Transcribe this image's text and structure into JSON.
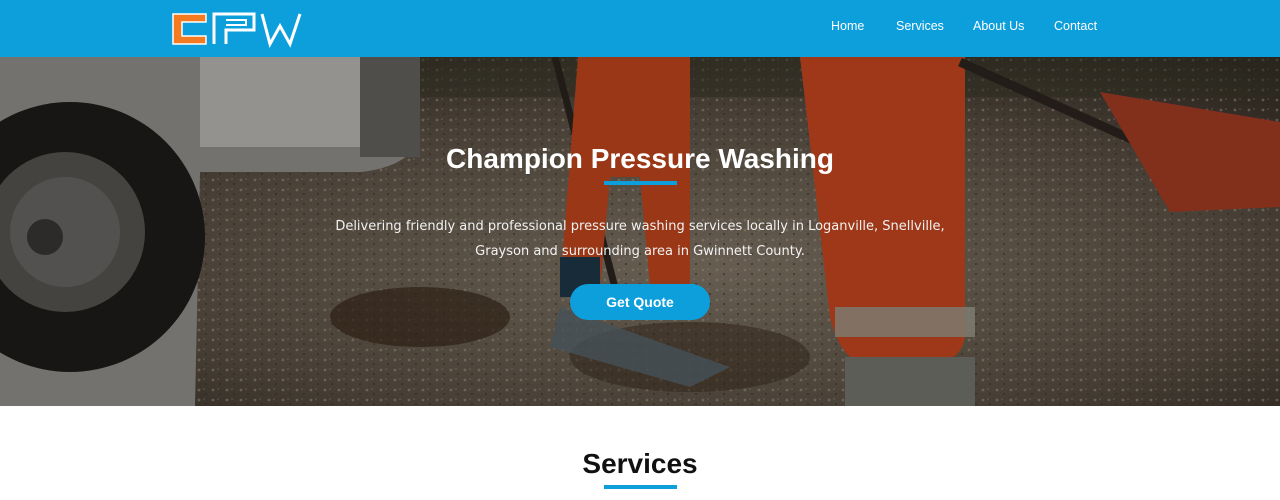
{
  "brand": {
    "logo_text": "CPW",
    "colors": {
      "primary": "#0d9fdc",
      "logo_orange": "#f47b20",
      "logo_white": "#ffffff"
    }
  },
  "nav": {
    "items": [
      {
        "label": "Home"
      },
      {
        "label": "Services"
      },
      {
        "label": "About Us"
      },
      {
        "label": "Contact"
      }
    ]
  },
  "hero": {
    "title": "Champion Pressure Washing",
    "description": "Delivering friendly and professional pressure washing services locally in Loganville, Snellville, Grayson and surrounding area in Gwinnett County.",
    "cta_label": "Get Quote",
    "background": "photo of workers in orange coveralls raking gravel beside a vehicle"
  },
  "services": {
    "title": "Services"
  }
}
